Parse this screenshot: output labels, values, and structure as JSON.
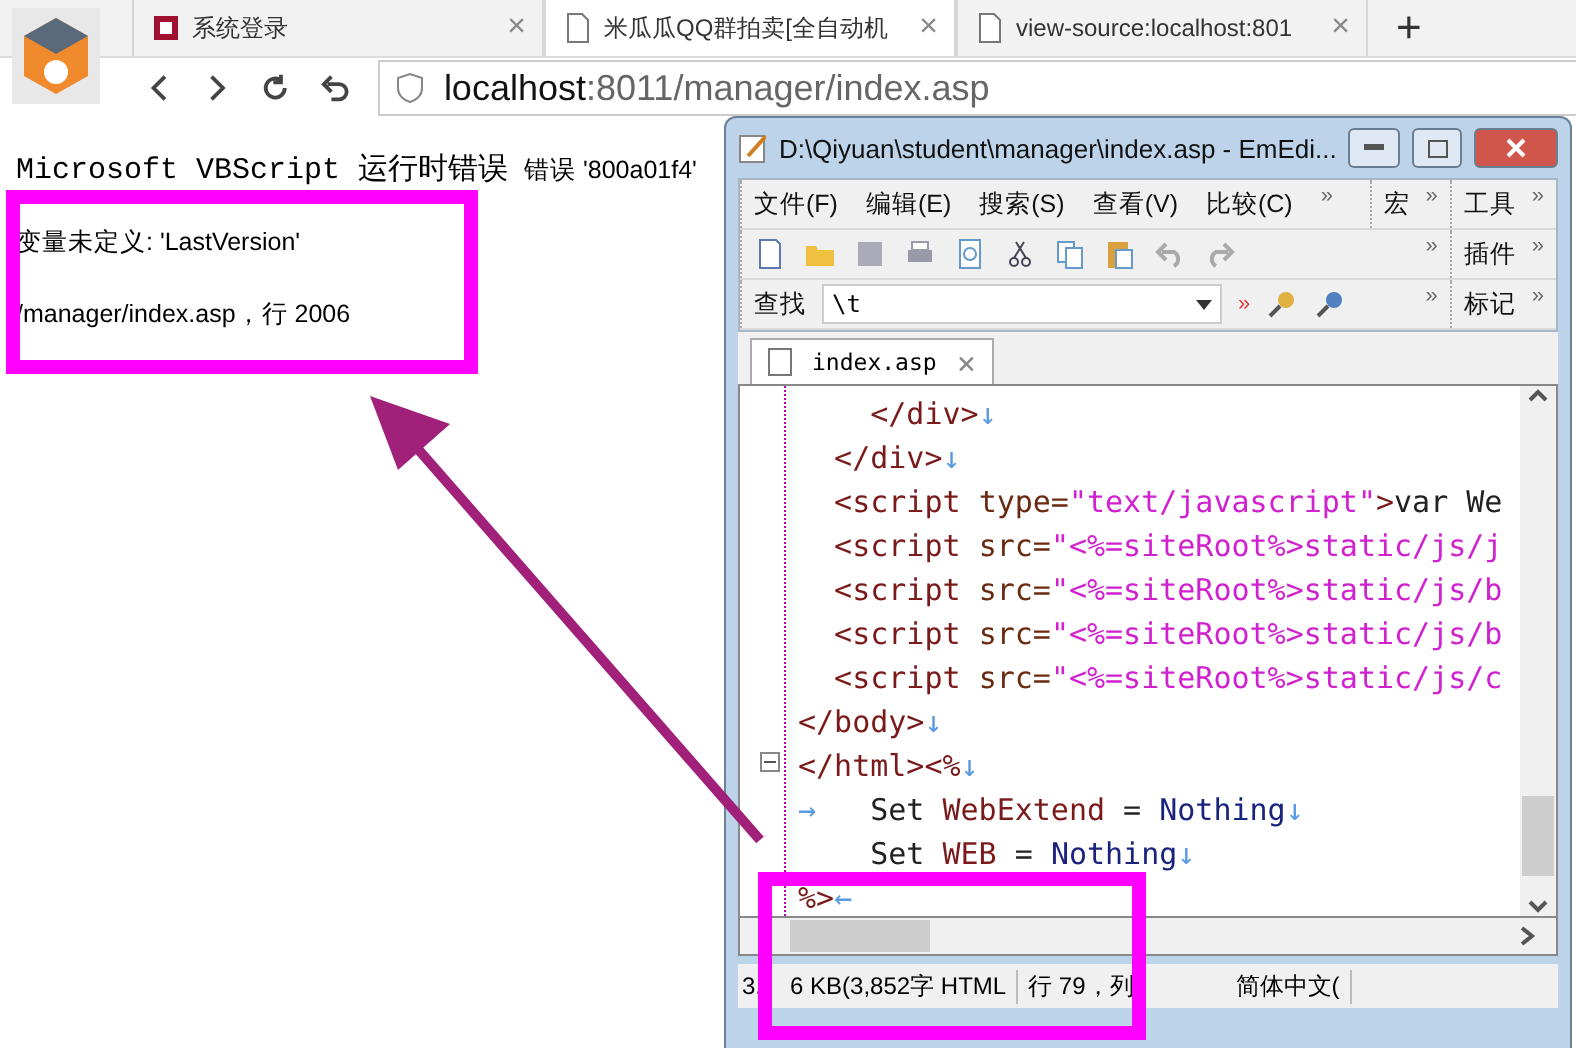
{
  "browser": {
    "tabs": [
      {
        "title": "系统登录",
        "selected": false,
        "kind": "site",
        "close": "×"
      },
      {
        "title": "米瓜瓜QQ群拍卖[全自动机",
        "selected": true,
        "kind": "doc",
        "close": "×"
      },
      {
        "title": "view-source:localhost:801",
        "selected": false,
        "kind": "doc",
        "close": "×"
      }
    ],
    "new_tab": "+",
    "address": {
      "host": "localhost",
      "path": ":8011/manager/index.asp"
    }
  },
  "error": {
    "heading": "Microsoft VBScript 运行时错误",
    "code": "错误 '800a01f4'",
    "message": "变量未定义: 'LastVersion'",
    "location": "/manager/index.asp，行 2006"
  },
  "editor": {
    "title": "D:\\Qiyuan\\student\\manager\\index.asp - EmEdi...",
    "menu": [
      "文件(F)",
      "编辑(E)",
      "搜索(S)",
      "查看(V)",
      "比较(C)"
    ],
    "chevron": "»",
    "side_menus": [
      "宏",
      "工具",
      "插件",
      "标记"
    ],
    "find": {
      "label": "查找",
      "value": "\\t",
      "extra": "»"
    },
    "file_tab": {
      "name": "index.asp",
      "close": "×"
    },
    "lines": [
      [
        {
          "kind": "tag",
          "text": "    </div>"
        },
        {
          "kind": "mark",
          "text": "↓"
        }
      ],
      [
        {
          "kind": "tag",
          "text": "  </div>"
        },
        {
          "kind": "mark",
          "text": "↓"
        }
      ],
      [
        {
          "kind": "tag",
          "text": "  <script "
        },
        {
          "kind": "attr",
          "text": "type="
        },
        {
          "kind": "string",
          "text": "\"text/javascript\""
        },
        {
          "kind": "tag",
          "text": ">"
        },
        {
          "kind": "keyword",
          "text": "var We"
        }
      ],
      [
        {
          "kind": "tag",
          "text": "  <script "
        },
        {
          "kind": "attr",
          "text": "src="
        },
        {
          "kind": "string",
          "text": "\"<%=siteRoot%>static/js/j"
        }
      ],
      [
        {
          "kind": "tag",
          "text": "  <script "
        },
        {
          "kind": "attr",
          "text": "src="
        },
        {
          "kind": "string",
          "text": "\"<%=siteRoot%>static/js/b"
        }
      ],
      [
        {
          "kind": "tag",
          "text": "  <script "
        },
        {
          "kind": "attr",
          "text": "src="
        },
        {
          "kind": "string",
          "text": "\"<%=siteRoot%>static/js/b"
        }
      ],
      [
        {
          "kind": "tag",
          "text": "  <script "
        },
        {
          "kind": "attr",
          "text": "src="
        },
        {
          "kind": "string",
          "text": "\"<%=siteRoot%>static/js/c"
        }
      ],
      [
        {
          "kind": "tag",
          "text": "</body>"
        },
        {
          "kind": "mark",
          "text": "↓"
        }
      ],
      [
        {
          "kind": "tag",
          "text": "</html><%"
        },
        {
          "kind": "mark",
          "text": "↓"
        }
      ],
      [
        {
          "kind": "mark",
          "text": "→"
        },
        {
          "kind": "keyword",
          "text": "   Set "
        },
        {
          "kind": "tag",
          "text": "WebExtend"
        },
        {
          "kind": "keyword",
          "text": " = "
        },
        {
          "kind": "value",
          "text": "Nothing"
        },
        {
          "kind": "mark",
          "text": "↓"
        }
      ],
      [
        {
          "kind": "keyword",
          "text": "    Set "
        },
        {
          "kind": "tag",
          "text": "WEB"
        },
        {
          "kind": "keyword",
          "text": " = "
        },
        {
          "kind": "value",
          "text": "Nothing"
        },
        {
          "kind": "mark",
          "text": "↓"
        }
      ],
      [
        {
          "kind": "tag",
          "text": "%>"
        },
        {
          "kind": "mark",
          "text": "←"
        }
      ]
    ],
    "status": {
      "size_a": "3.",
      "size_b": "6 KB(3,852字",
      "type": "HTML",
      "position": "行 79，列",
      "encoding": "简体中文("
    }
  }
}
